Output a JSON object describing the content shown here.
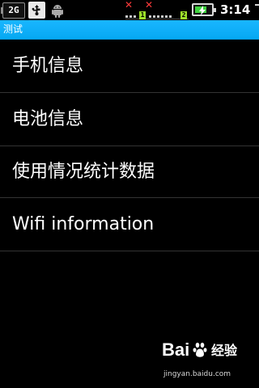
{
  "status_bar": {
    "network_label": "2G",
    "time": "3:14 下午",
    "signal_digit_1": "1",
    "signal_digit_2": "2",
    "icons": {
      "usb": "usb-icon",
      "android": "android-icon",
      "signal_off_1": "x-icon",
      "signal_off_2": "x-icon",
      "battery": "battery-charging-icon"
    },
    "colors": {
      "x": "#ff3a3a",
      "battery": "#3fd23f",
      "signal_digit_bg": "#9cde2a"
    },
    "battery_level": 0.75
  },
  "titlebar": {
    "title": "测试",
    "color": "#06a8f2"
  },
  "menu": {
    "items": [
      {
        "label": "手机信息"
      },
      {
        "label": "电池信息"
      },
      {
        "label": "使用情况统计数据"
      },
      {
        "label": "Wifi information"
      }
    ]
  },
  "watermark": {
    "logo_text": "Bai度经验",
    "url": "jingyan.baidu.com"
  }
}
